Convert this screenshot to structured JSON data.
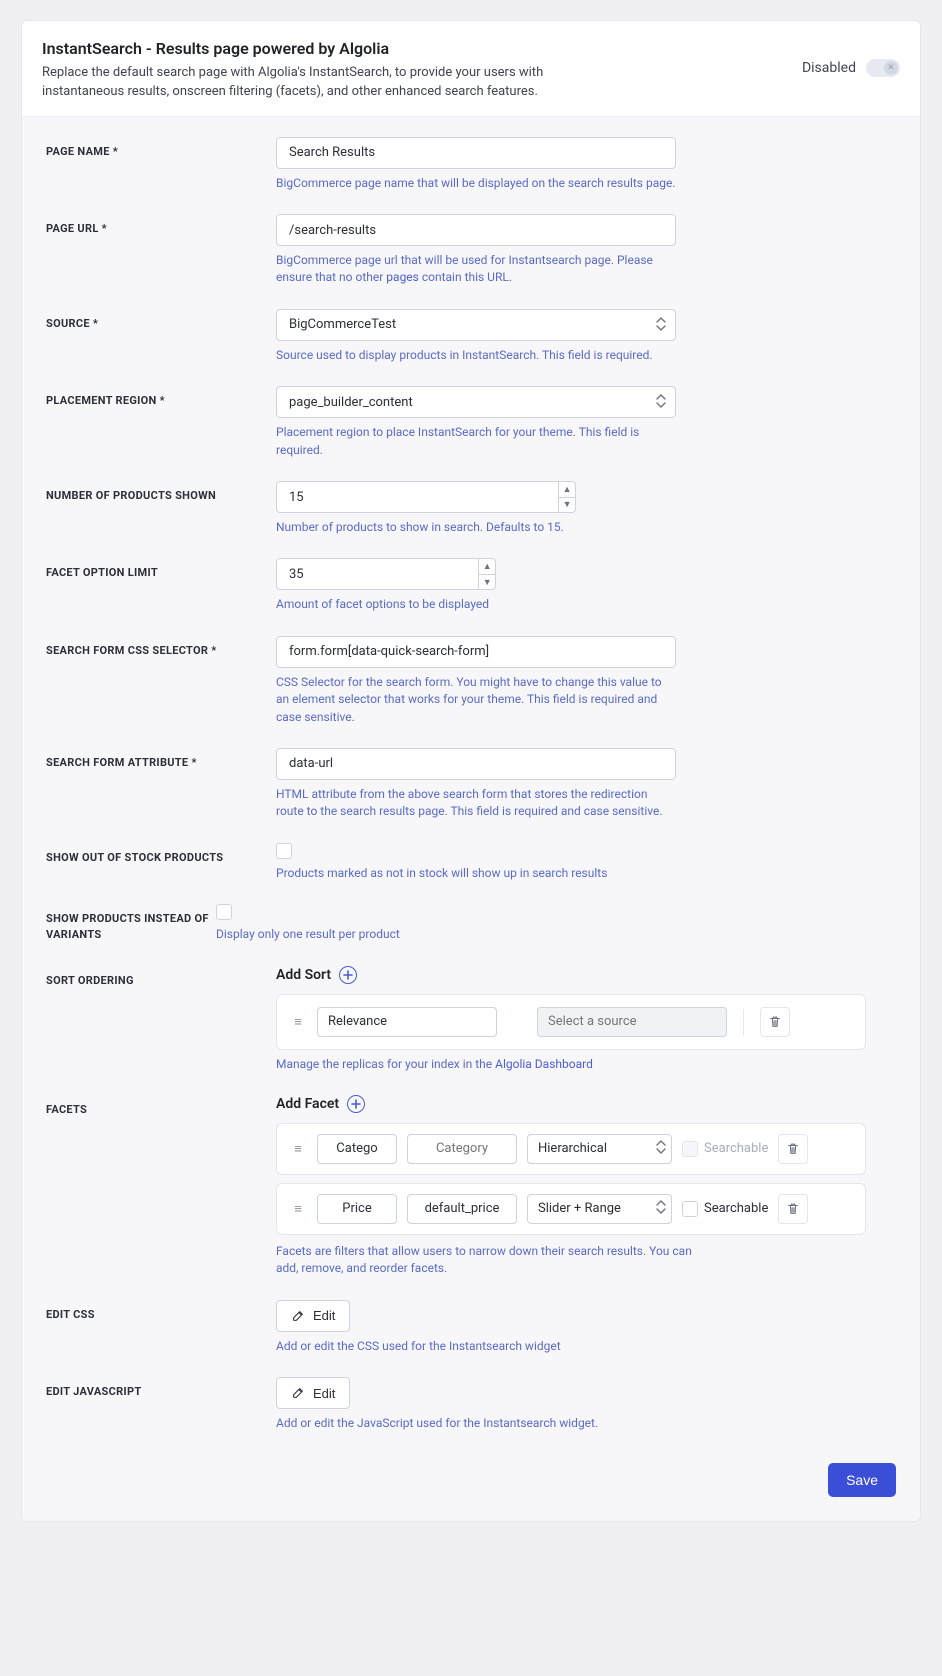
{
  "header": {
    "title": "InstantSearch - Results page powered by Algolia",
    "description": "Replace the default search page with Algolia's InstantSearch, to provide your users with instantaneous results, onscreen filtering (facets), and other enhanced search features.",
    "status_label": "Disabled"
  },
  "fields": {
    "page_name": {
      "label": "PAGE NAME *",
      "value": "Search Results",
      "help": "BigCommerce page name that will be displayed on the search results page."
    },
    "page_url": {
      "label": "PAGE URL *",
      "value": "/search-results",
      "help_prefix": "BigCommerce page url that will be used for Instantsearch page. Please ensure that no other ",
      "help_link": "pages",
      "help_suffix": " contain this URL."
    },
    "source": {
      "label": "SOURCE *",
      "value": "BigCommerceTest",
      "help": "Source used to display products in InstantSearch. This field is required."
    },
    "placement_region": {
      "label": "PLACEMENT REGION *",
      "value": "page_builder_content",
      "help": "Placement region to place InstantSearch for your theme. This field is required."
    },
    "num_products": {
      "label": "NUMBER OF PRODUCTS SHOWN",
      "value": "15",
      "help": "Number of products to show in search. Defaults to 15."
    },
    "facet_limit": {
      "label": "FACET OPTION LIMIT",
      "value": "35",
      "help": "Amount of facet options to be displayed"
    },
    "css_selector": {
      "label": "SEARCH FORM CSS SELECTOR *",
      "value": "form.form[data-quick-search-form]",
      "help": "CSS Selector for the search form. You might have to change this value to an element selector that works for your theme. This field is required and case sensitive."
    },
    "form_attr": {
      "label": "SEARCH FORM ATTRIBUTE *",
      "value": "data-url",
      "help": "HTML attribute from the above search form that stores the redirection route to the search results page. This field is required and case sensitive."
    },
    "out_of_stock": {
      "label": "SHOW OUT OF STOCK PRODUCTS",
      "help": "Products marked as not in stock will show up in search results"
    },
    "products_variants": {
      "label": "SHOW PRODUCTS INSTEAD OF VARIANTS",
      "help": "Display only one result per product"
    }
  },
  "sort": {
    "label": "SORT ORDERING",
    "add_label": "Add Sort",
    "item": {
      "name": "Relevance",
      "source_placeholder": "Select a source"
    },
    "help_prefix": "Manage the replicas for your index in the ",
    "help_link": "Algolia Dashboard"
  },
  "facets": {
    "label": "FACETS",
    "add_label": "Add Facet",
    "searchable_label": "Searchable",
    "items": [
      {
        "name": "Catego",
        "attr_placeholder": "Category",
        "attr_value": "",
        "type": "Hierarchical",
        "searchable_muted": true
      },
      {
        "name": "Price",
        "attr_placeholder": "",
        "attr_value": "default_price",
        "type": "Slider + Range",
        "searchable_muted": false
      }
    ],
    "help": "Facets are filters that allow users to narrow down their search results. You can add, remove, and reorder facets."
  },
  "edit_css": {
    "label": "EDIT CSS",
    "button": "Edit",
    "help": "Add or edit the CSS used for the Instantsearch widget"
  },
  "edit_js": {
    "label": "EDIT JAVASCRIPT",
    "button": "Edit",
    "help": "Add or edit the JavaScript used for the Instantsearch widget."
  },
  "footer": {
    "save": "Save"
  }
}
